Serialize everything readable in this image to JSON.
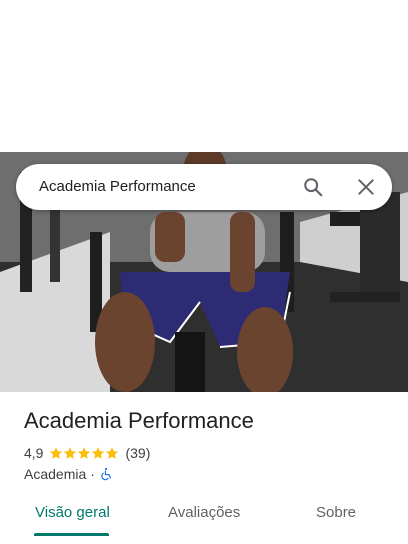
{
  "search": {
    "query": "Academia Performance",
    "search_icon": "search-icon",
    "close_icon": "close-icon"
  },
  "place": {
    "name": "Academia Performance",
    "rating": "4,9",
    "stars": 5,
    "reviews_count": "(39)",
    "category": "Academia",
    "separator": "·",
    "accessibility_icon": "wheelchair-icon"
  },
  "tabs": [
    {
      "label": "Visão geral",
      "active": true
    },
    {
      "label": "Avaliações",
      "active": false
    },
    {
      "label": "Sobre",
      "active": false
    }
  ],
  "colors": {
    "accent": "#00796b",
    "star": "#fbbc04",
    "wheelchair": "#1a73e8"
  }
}
